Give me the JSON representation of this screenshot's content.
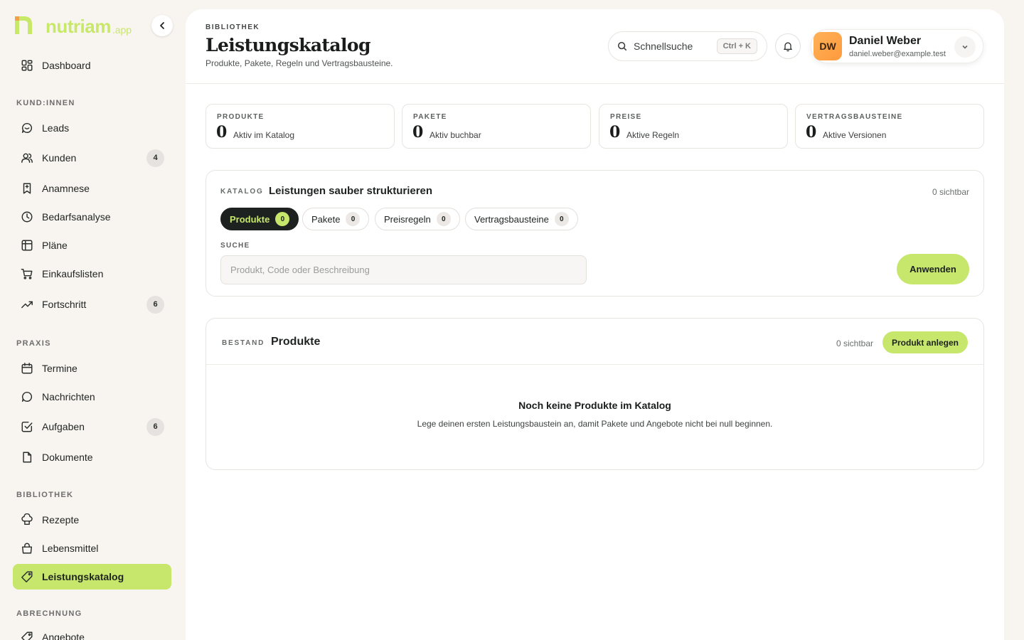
{
  "brand": {
    "name": "nutriam",
    "suffix": ".app"
  },
  "sidebar": {
    "dashboard": {
      "label": "Dashboard"
    },
    "sections": {
      "customers": "KUND:INNEN",
      "practice": "PRAXIS",
      "library": "BIBLIOTHEK",
      "billing": "ABRECHNUNG"
    },
    "items": {
      "leads": {
        "label": "Leads"
      },
      "kunden": {
        "label": "Kunden",
        "badge": "4"
      },
      "anamnese": {
        "label": "Anamnese"
      },
      "bedarfsanalyse": {
        "label": "Bedarfsanalyse"
      },
      "plaene": {
        "label": "Pläne"
      },
      "einkaufslisten": {
        "label": "Einkaufslisten"
      },
      "fortschritt": {
        "label": "Fortschritt",
        "badge": "6"
      },
      "termine": {
        "label": "Termine"
      },
      "nachrichten": {
        "label": "Nachrichten"
      },
      "aufgaben": {
        "label": "Aufgaben",
        "badge": "6"
      },
      "dokumente": {
        "label": "Dokumente"
      },
      "rezepte": {
        "label": "Rezepte"
      },
      "lebensmittel": {
        "label": "Lebensmittel"
      },
      "leistungskatalog": {
        "label": "Leistungskatalog",
        "active": true
      },
      "angebote": {
        "label": "Angebote"
      }
    }
  },
  "header": {
    "eyebrow": "BIBLIOTHEK",
    "title": "Leistungskatalog",
    "subtitle": "Produkte, Pakete, Regeln und Vertragsbausteine.",
    "search_label": "Schnellsuche",
    "shortcut": "Ctrl + K",
    "user": {
      "initials": "DW",
      "name": "Daniel Weber",
      "email": "daniel.weber@example.test"
    }
  },
  "stats": [
    {
      "label": "PRODUKTE",
      "value": "0",
      "desc": "Aktiv im Katalog"
    },
    {
      "label": "PAKETE",
      "value": "0",
      "desc": "Aktiv buchbar"
    },
    {
      "label": "PREISE",
      "value": "0",
      "desc": "Aktive Regeln"
    },
    {
      "label": "VERTRAGSBAUSTEINE",
      "value": "0",
      "desc": "Aktive Versionen"
    }
  ],
  "catalog": {
    "eyebrow": "KATALOG",
    "title": "Leistungen sauber strukturieren",
    "visible": "0 sichtbar",
    "tabs": [
      {
        "label": "Produkte",
        "count": "0",
        "active": true
      },
      {
        "label": "Pakete",
        "count": "0"
      },
      {
        "label": "Preisregeln",
        "count": "0"
      },
      {
        "label": "Vertragsbausteine",
        "count": "0"
      }
    ],
    "search_label": "SUCHE",
    "search_placeholder": "Produkt, Code oder Beschreibung",
    "search_value": "",
    "apply_label": "Anwenden"
  },
  "products": {
    "eyebrow": "BESTAND",
    "title": "Produkte",
    "visible": "0 sichtbar",
    "create_label": "Produkt anlegen",
    "empty_title": "Noch keine Produkte im Katalog",
    "empty_text": "Lege deinen ersten Leistungsbaustein an, damit Pakete und Angebote nicht bei null beginnen."
  },
  "colors": {
    "accent": "#c6e76b",
    "brand": "#c8e86a",
    "dark": "#1d211f",
    "avatar": "#ffa84a"
  }
}
